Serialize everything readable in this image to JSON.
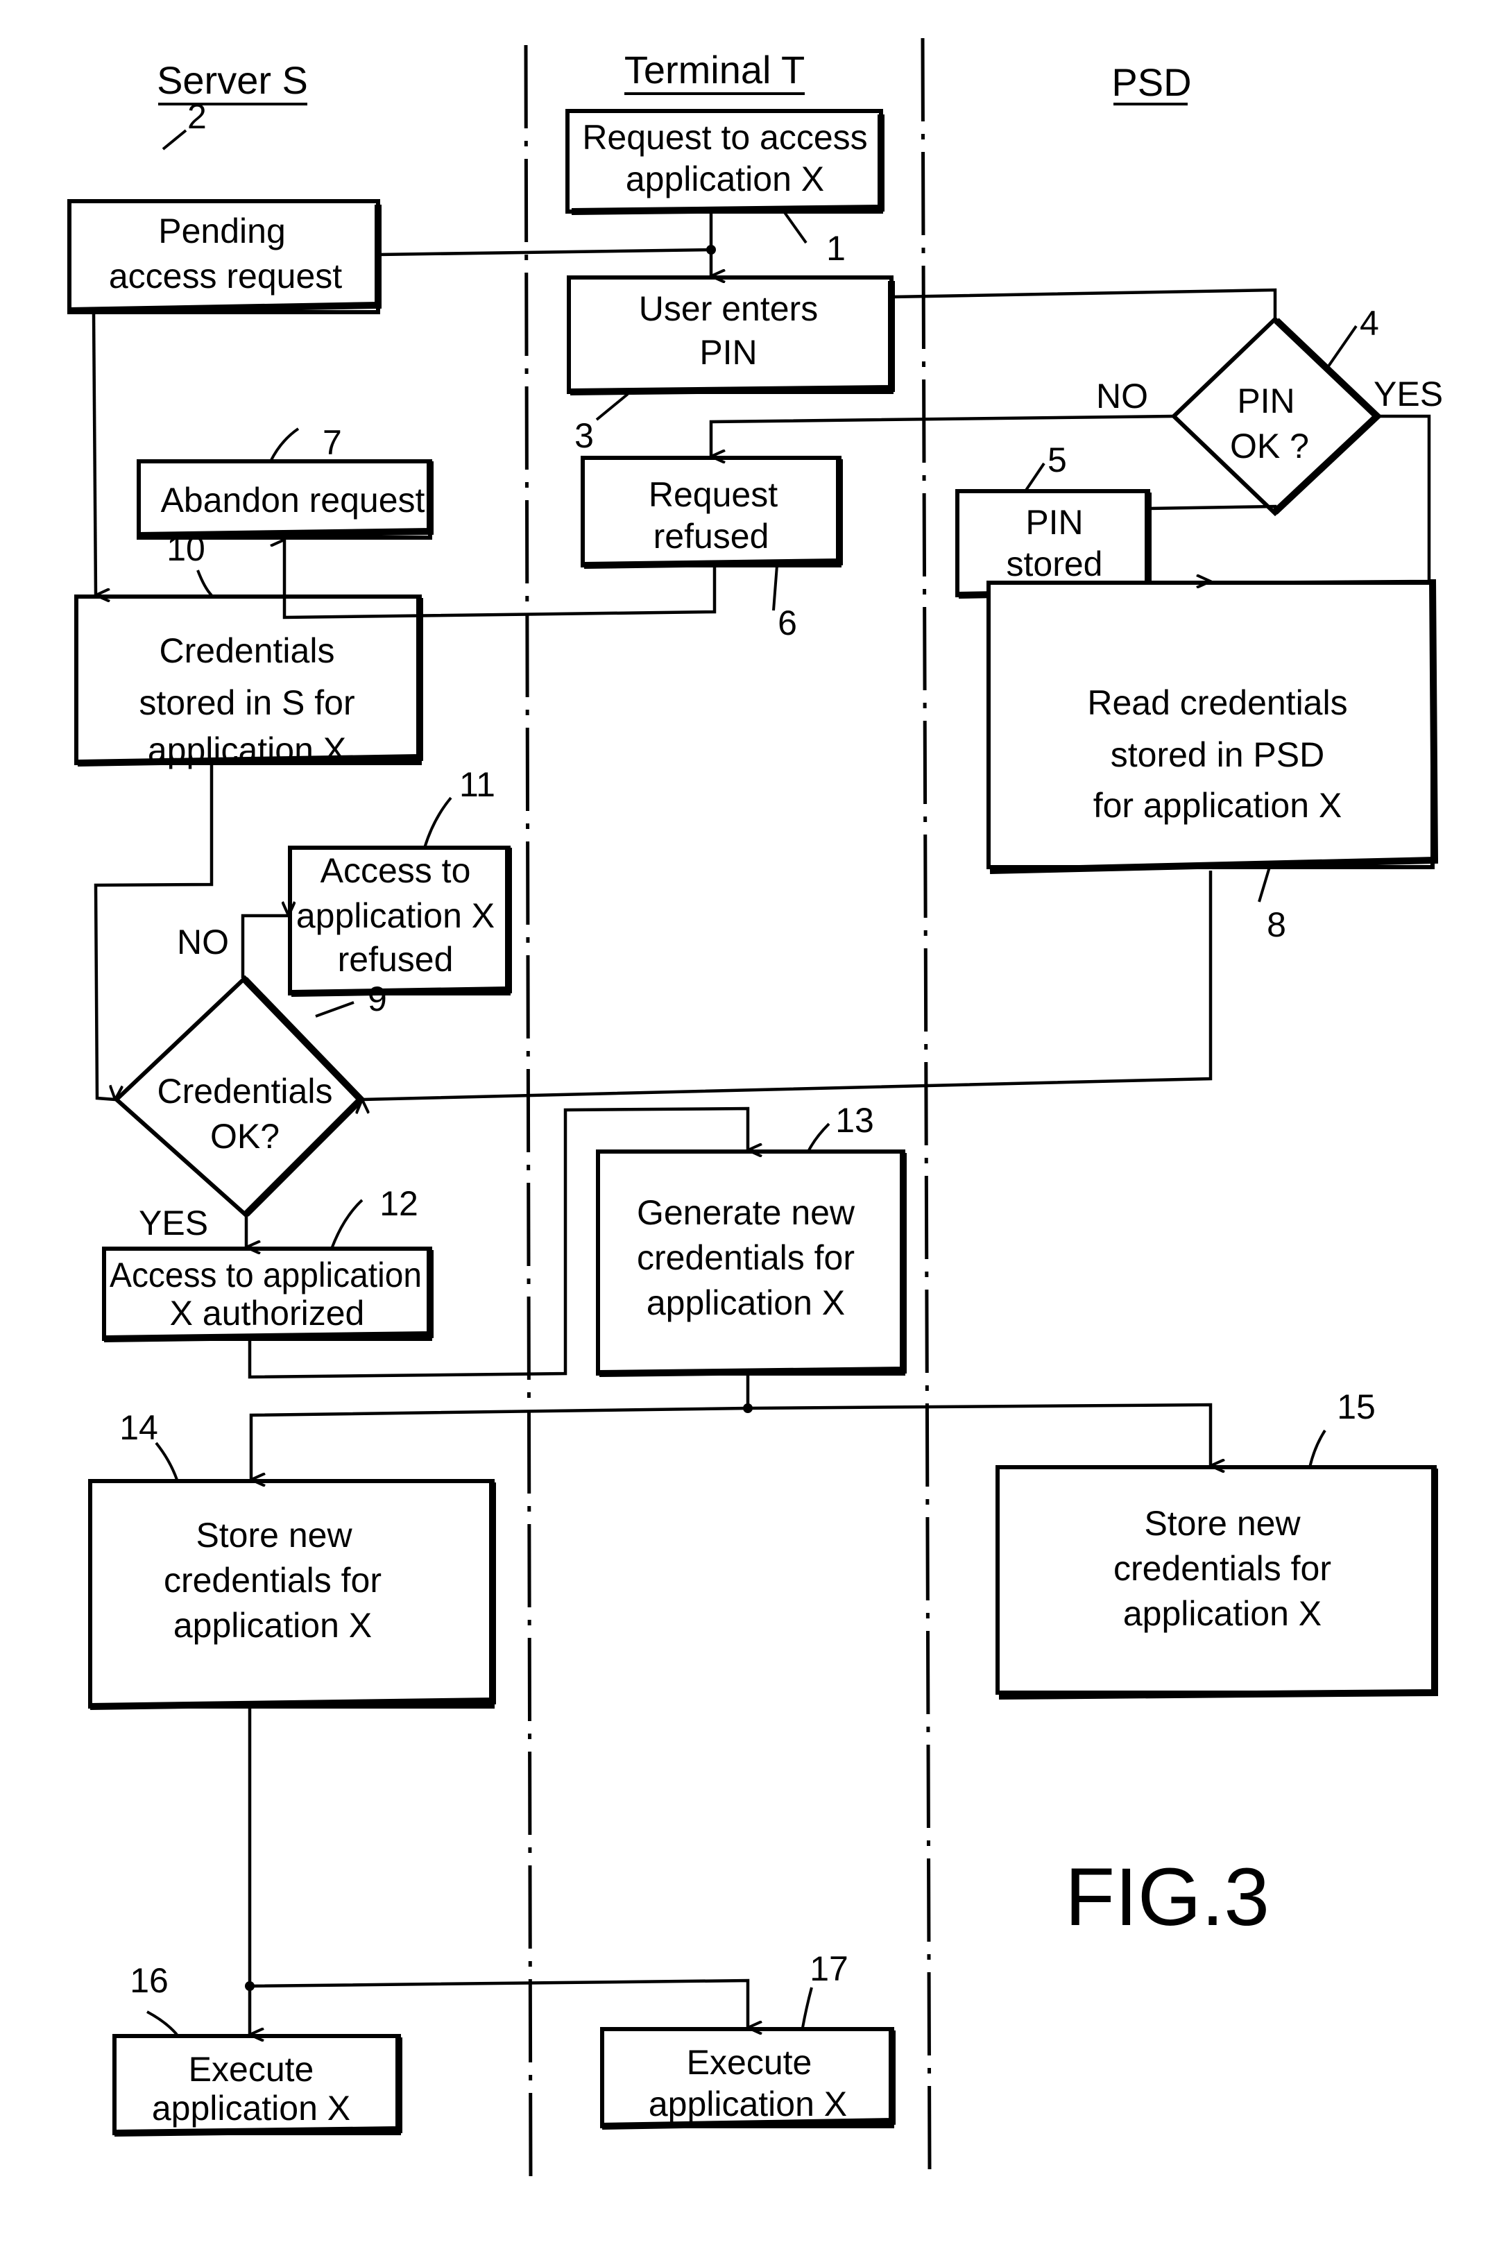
{
  "figure_label": "FIG.3",
  "lanes": [
    {
      "id": "server",
      "title": "Server S"
    },
    {
      "id": "terminal",
      "title": "Terminal T"
    },
    {
      "id": "psd",
      "title": "PSD"
    }
  ],
  "steps": [
    {
      "ref": "1",
      "lane": "terminal",
      "type": "process",
      "lines": [
        "Request to access",
        "application X"
      ]
    },
    {
      "ref": "2",
      "lane": "server",
      "type": "process",
      "lines": [
        "Pending",
        "access request"
      ]
    },
    {
      "ref": "3",
      "lane": "terminal",
      "type": "process",
      "lines": [
        "User enters",
        "PIN"
      ]
    },
    {
      "ref": "4",
      "lane": "psd",
      "type": "decision",
      "lines": [
        "PIN",
        "OK ?"
      ]
    },
    {
      "ref": "5",
      "lane": "psd",
      "type": "process",
      "lines": [
        "PIN",
        "stored"
      ]
    },
    {
      "ref": "6",
      "lane": "terminal",
      "type": "process",
      "lines": [
        "Request",
        "refused"
      ]
    },
    {
      "ref": "7",
      "lane": "server",
      "type": "process",
      "lines": [
        "Abandon request"
      ]
    },
    {
      "ref": "8",
      "lane": "psd",
      "type": "process",
      "lines": [
        "Read credentials",
        "stored in PSD",
        "for application X"
      ]
    },
    {
      "ref": "9",
      "lane": "server",
      "type": "decision",
      "lines": [
        "Credentials",
        "OK?"
      ]
    },
    {
      "ref": "10",
      "lane": "server",
      "type": "process",
      "lines": [
        "Credentials",
        "stored in S for",
        "application X"
      ]
    },
    {
      "ref": "11",
      "lane": "server",
      "type": "process",
      "lines": [
        "Access to",
        "application X",
        "refused"
      ]
    },
    {
      "ref": "12",
      "lane": "server",
      "type": "process",
      "lines": [
        "Access to application",
        "X authorized"
      ]
    },
    {
      "ref": "13",
      "lane": "terminal",
      "type": "process",
      "lines": [
        "Generate new",
        "credentials for",
        "application X"
      ]
    },
    {
      "ref": "14",
      "lane": "server",
      "type": "process",
      "lines": [
        "Store new",
        "credentials for",
        "application X"
      ]
    },
    {
      "ref": "15",
      "lane": "psd",
      "type": "process",
      "lines": [
        "Store new",
        "credentials for",
        "application X"
      ]
    },
    {
      "ref": "16",
      "lane": "server",
      "type": "process",
      "lines": [
        "Execute",
        "application X"
      ]
    },
    {
      "ref": "17",
      "lane": "terminal",
      "type": "process",
      "lines": [
        "Execute",
        "application X"
      ]
    }
  ],
  "branch_labels": {
    "pin_no": "NO",
    "pin_yes": "YES",
    "cred_no": "NO",
    "cred_yes": "YES"
  },
  "connections": [
    {
      "from": "1",
      "to": "3"
    },
    {
      "from": "2",
      "to": "3"
    },
    {
      "from": "2",
      "to": "10"
    },
    {
      "from": "3",
      "to": "4"
    },
    {
      "from": "4",
      "to": "6",
      "label": "NO"
    },
    {
      "from": "4",
      "to": "8",
      "label": "YES"
    },
    {
      "from": "5",
      "to": "4"
    },
    {
      "from": "6",
      "to": "7"
    },
    {
      "from": "10",
      "to": "9"
    },
    {
      "from": "8",
      "to": "9"
    },
    {
      "from": "9",
      "to": "11",
      "label": "NO"
    },
    {
      "from": "9",
      "to": "12",
      "label": "YES"
    },
    {
      "from": "12",
      "to": "13"
    },
    {
      "from": "13",
      "to": "14"
    },
    {
      "from": "13",
      "to": "15"
    },
    {
      "from": "14",
      "to": "16"
    },
    {
      "from": "14",
      "to": "17"
    }
  ]
}
